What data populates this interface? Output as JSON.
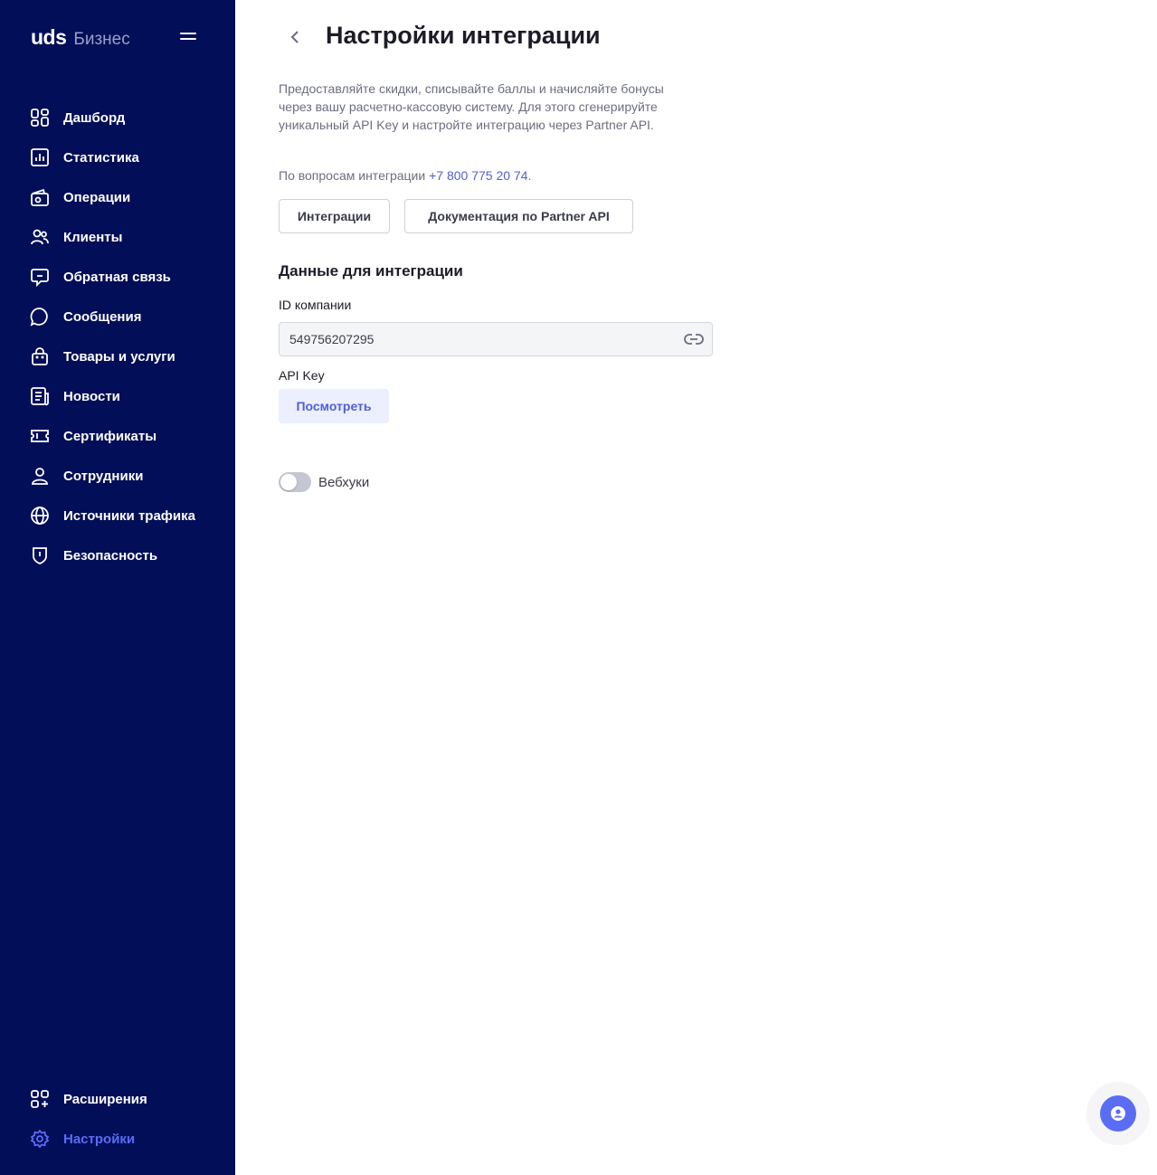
{
  "brand": {
    "logo": "uds",
    "subtitle": "Бизнес"
  },
  "colors": {
    "sidebar_bg": "#020e58",
    "accent": "#5b6cf5",
    "link": "#4f5fd6"
  },
  "sidebar": {
    "items": [
      {
        "label": "Дашборд",
        "icon": "dashboard-icon"
      },
      {
        "label": "Статистика",
        "icon": "chart-icon"
      },
      {
        "label": "Операции",
        "icon": "wallet-icon"
      },
      {
        "label": "Клиенты",
        "icon": "users-icon"
      },
      {
        "label": "Обратная связь",
        "icon": "feedback-icon"
      },
      {
        "label": "Сообщения",
        "icon": "message-icon"
      },
      {
        "label": "Товары и услуги",
        "icon": "bag-icon"
      },
      {
        "label": "Новости",
        "icon": "news-icon"
      },
      {
        "label": "Сертификаты",
        "icon": "ticket-icon"
      },
      {
        "label": "Сотрудники",
        "icon": "person-icon"
      },
      {
        "label": "Источники трафика",
        "icon": "globe-icon"
      },
      {
        "label": "Безопасность",
        "icon": "shield-icon"
      }
    ],
    "bottom": [
      {
        "label": "Расширения",
        "icon": "extensions-icon"
      },
      {
        "label": "Настройки",
        "icon": "gear-icon",
        "active": true
      }
    ]
  },
  "page": {
    "title": "Настройки интеграции",
    "description": "Предоставляйте скидки, списывайте баллы и начисляйте бонусы через вашу расчетно-кассовую систему. Для этого сгенерируйте уникальный API Key и настройте интеграцию через Partner API.",
    "contact_prefix": "По вопросам интеграции ",
    "contact_phone": "+7 800 775 20 74",
    "contact_suffix": ".",
    "integrations_button": "Интеграции",
    "docs_button": "Документация по Partner API",
    "section_title": "Данные для интеграции",
    "company_id_label": "ID компании",
    "company_id_value": "549756207295",
    "api_key_label": "API Key",
    "view_button": "Посмотреть",
    "webhooks_label": "Вебхуки",
    "webhooks_enabled": false
  }
}
